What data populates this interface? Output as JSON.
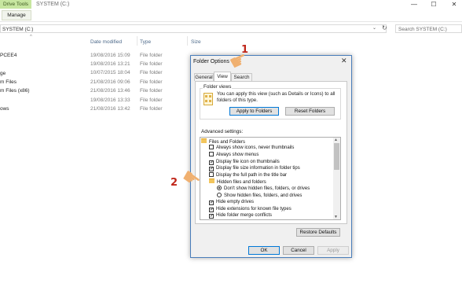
{
  "ribbon": {
    "context_tab": "Drive Tools",
    "manage_tab": "Manage"
  },
  "window": {
    "title": "SYSTEM (C:)",
    "minimize": "—",
    "maximize": "☐",
    "close": "✕"
  },
  "address": {
    "path": "SYSTEM (C:)",
    "chevron": "⌄",
    "refresh": "↻"
  },
  "search": {
    "placeholder": "Search SYSTEM (C:)"
  },
  "columns": {
    "sort_caret": "^",
    "date": "Date modified",
    "type": "Type",
    "size": "Size"
  },
  "nav": [
    "PCEE4",
    "",
    "ge",
    "m Files",
    "m Files (x86)",
    "",
    "ows"
  ],
  "rows": [
    {
      "date": "19/08/2016 15:09",
      "type": "File folder"
    },
    {
      "date": "19/08/2016 13:21",
      "type": "File folder"
    },
    {
      "date": "10/07/2015 18:04",
      "type": "File folder"
    },
    {
      "date": "21/08/2016 09:06",
      "type": "File folder"
    },
    {
      "date": "21/08/2016 13:46",
      "type": "File folder"
    },
    {
      "date": "19/08/2016 13:33",
      "type": "File folder"
    },
    {
      "date": "21/08/2016 13:42",
      "type": "File folder"
    }
  ],
  "dialog": {
    "title": "Folder Options",
    "close": "✕",
    "tabs": [
      "General",
      "View",
      "Search"
    ],
    "folder_views": {
      "label": "Folder views",
      "text": "You can apply this view (such as Details or Icons) to all folders of this type.",
      "apply_button": "Apply to Folders",
      "reset_button": "Reset Folders"
    },
    "advanced_label": "Advanced settings:",
    "items": [
      {
        "kind": "folder",
        "text": "Files and Folders"
      },
      {
        "kind": "check",
        "checked": false,
        "text": "Always show icons, never thumbnails"
      },
      {
        "kind": "check",
        "checked": false,
        "text": "Always show menus"
      },
      {
        "kind": "check",
        "checked": true,
        "text": "Display file icon on thumbnails"
      },
      {
        "kind": "check",
        "checked": true,
        "text": "Display file size information in folder tips"
      },
      {
        "kind": "check",
        "checked": false,
        "text": "Display the full path in the title bar"
      },
      {
        "kind": "folder",
        "text": "Hidden files and folders"
      },
      {
        "kind": "radio",
        "checked": true,
        "text": "Don't show hidden files, folders, or drives"
      },
      {
        "kind": "radio",
        "checked": false,
        "text": "Show hidden files, folders, and drives"
      },
      {
        "kind": "check",
        "checked": true,
        "text": "Hide empty drives"
      },
      {
        "kind": "check",
        "checked": true,
        "text": "Hide extensions for known file types"
      },
      {
        "kind": "check",
        "checked": true,
        "text": "Hide folder merge conflicts"
      }
    ],
    "restore_button": "Restore Defaults",
    "ok_button": "OK",
    "cancel_button": "Cancel",
    "apply_button": "Apply"
  },
  "annotations": {
    "step1": "1",
    "step2": "2",
    "hand_icon": "pointing-hand-icon"
  },
  "colors": {
    "accent": "#0078d7",
    "badge": "#c0261a",
    "hand": "#f0b070",
    "context_tab": "#c7e6a0"
  }
}
